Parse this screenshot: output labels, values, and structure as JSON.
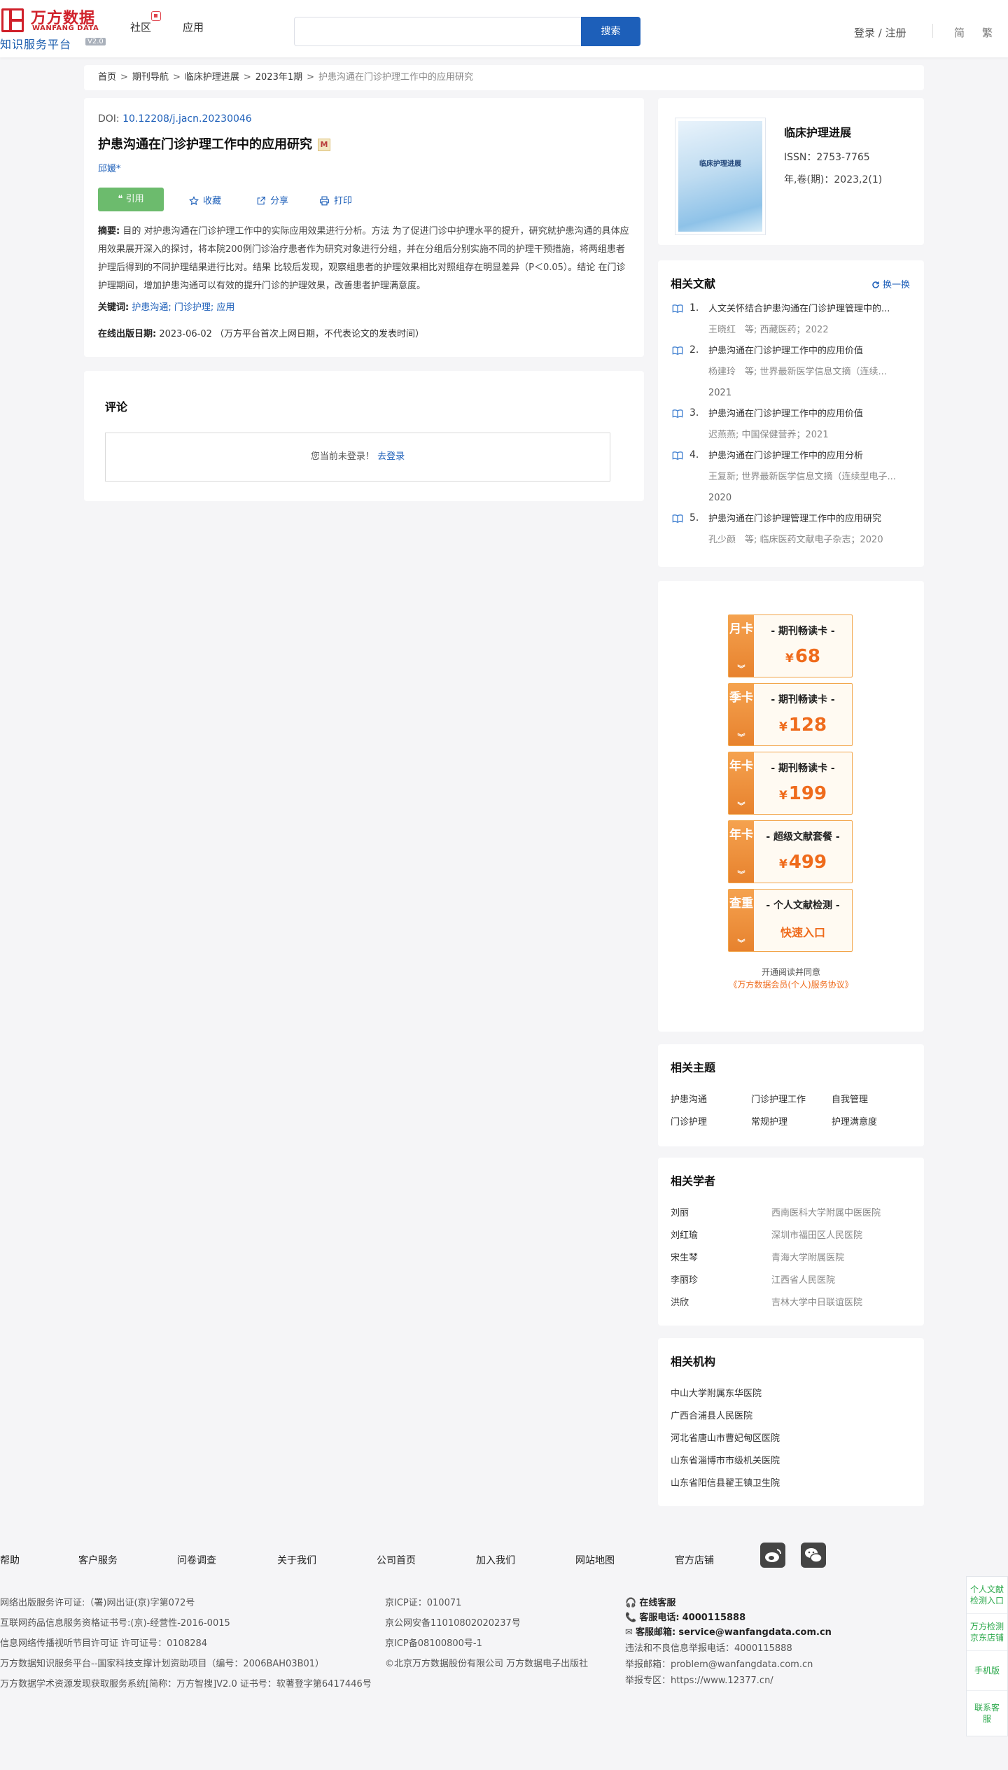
{
  "header": {
    "logo_cn": "万方数据",
    "logo_en": "WANFANG DATA",
    "logo_sub": "知识服务平台",
    "logo_version": "V2.0",
    "nav_community": "社区",
    "nav_apps": "应用",
    "search_placeholder": "",
    "search_button": "搜索",
    "login": "登录 / 注册",
    "lang_simplified": "简",
    "lang_traditional": "繁"
  },
  "breadcrumb": [
    "首页",
    "期刊导航",
    "临床护理进展",
    "2023年1期",
    "护患沟通在门诊护理工作中的应用研究"
  ],
  "article": {
    "doi_label": "DOI: ",
    "doi": "10.12208/j.jacn.20230046",
    "title": "护患沟通在门诊护理工作中的应用研究",
    "m_badge": "M",
    "author": "邱媛*",
    "cite": "引用",
    "favorite": "收藏",
    "share": "分享",
    "print": "打印",
    "abstract_label": "摘要:",
    "abstract_text": " 目的 对护患沟通在门诊护理工作中的实际应用效果进行分析。方法 为了促进门诊中护理水平的提升，研究就护患沟通的具体应用效果展开深入的探讨，将本院200例门诊治疗患者作为研究对象进行分组，并在分组后分别实施不同的护理干预措施，将两组患者护理后得到的不同护理结果进行比对。结果 比较后发现，观察组患者的护理效果相比对照组存在明显差异（P＜0.05）。结论 在门诊护理期间，增加护患沟通可以有效的提升门诊的护理效果，改善患者护理满意度。",
    "keywords_label": "关键词:",
    "keywords": "护患沟通; 门诊护理; 应用",
    "pubdate_label": "在线出版日期:",
    "pubdate": "2023-06-02 （万方平台首次上网日期，不代表论文的发表时间）"
  },
  "comment": {
    "heading": "评论",
    "not_logged": "您当前未登录！",
    "go_login": "去登录"
  },
  "journal": {
    "cover_text": "临床护理进展",
    "name": "临床护理进展",
    "issn": "ISSN：2753-7765",
    "vol": "年,卷(期)：2023,2(1)"
  },
  "related": {
    "heading": "相关文献",
    "refresh": "换一换",
    "items": [
      {
        "num": "1.",
        "title": "人文关怀结合护患沟通在门诊护理管理中的...",
        "meta": "王晓红　等;  西藏医药；2022",
        "year": ""
      },
      {
        "num": "2.",
        "title": "护患沟通在门诊护理工作中的应用价值",
        "meta": "杨建玲　等;  世界最新医学信息文摘（连续...",
        "year": "2021"
      },
      {
        "num": "3.",
        "title": "护患沟通在门诊护理工作中的应用价值",
        "meta": "迟燕燕;  中国保健营养；2021",
        "year": ""
      },
      {
        "num": "4.",
        "title": "护患沟通在门诊护理工作中的应用分析",
        "meta": "王复新;  世界最新医学信息文摘（连续型电子...",
        "year": "2020"
      },
      {
        "num": "5.",
        "title": "护患沟通在门诊护理管理工作中的应用研究",
        "meta": "孔少颜　等;  临床医药文献电子杂志；2020",
        "year": ""
      }
    ]
  },
  "promo": {
    "cards": [
      {
        "tag": "月卡",
        "title": "- 期刊畅读卡 -",
        "price": "68",
        "entry": ""
      },
      {
        "tag": "季卡",
        "title": "- 期刊畅读卡 -",
        "price": "128",
        "entry": ""
      },
      {
        "tag": "年卡",
        "title": "- 期刊畅读卡 -",
        "price": "199",
        "entry": ""
      },
      {
        "tag": "年卡",
        "title": "- 超级文献套餐 -",
        "price": "499",
        "entry": ""
      },
      {
        "tag": "查重",
        "title": "- 个人文献检测 -",
        "price": "",
        "entry": "快速入口"
      }
    ],
    "yen": "¥",
    "chevron": "︾",
    "note": "开通阅读并同意",
    "agreement": "《万方数据会员(个人)服务协议》"
  },
  "topics": {
    "heading": "相关主题",
    "items": [
      "护患沟通",
      "门诊护理工作",
      "自我管理",
      "门诊护理",
      "常规护理",
      "护理满意度"
    ]
  },
  "scholars": {
    "heading": "相关学者",
    "items": [
      {
        "name": "刘丽",
        "org": "西南医科大学附属中医医院"
      },
      {
        "name": "刘红瑜",
        "org": "深圳市福田区人民医院"
      },
      {
        "name": "宋生琴",
        "org": "青海大学附属医院"
      },
      {
        "name": "李丽珍",
        "org": "江西省人民医院"
      },
      {
        "name": "洪欣",
        "org": "吉林大学中日联谊医院"
      }
    ]
  },
  "orgs": {
    "heading": "相关机构",
    "items": [
      "中山大学附属东华医院",
      "广西合浦县人民医院",
      "河北省唐山市曹妃甸区医院",
      "山东省淄博市市级机关医院",
      "山东省阳信县翟王镇卫生院"
    ]
  },
  "footer": {
    "nav": [
      "帮助",
      "客户服务",
      "问卷调查",
      "关于我们",
      "公司首页",
      "加入我们",
      "网站地图",
      "官方店铺"
    ],
    "left_lines": [
      "网络出版服务许可证:（署)网出证(京)字第072号",
      "互联网药品信息服务资格证书号:(京)-经营性-2016-0015",
      "信息网络传播视听节目许可证 许可证号：0108284",
      "万方数据知识服务平台--国家科技支撑计划资助项目（编号：2006BAH03B01）",
      "万方数据学术资源发现获取服务系统[简称：万方智搜]V2.0 证书号：软著登字第6417446号"
    ],
    "mid_lines": [
      "京ICP证：010071",
      "京公网安备11010802020237号",
      "京ICP备08100800号-1",
      "©北京万方数据股份有限公司 万方数据电子出版社"
    ],
    "online_service": "在线客服",
    "phone_label": "客服电话:",
    "phone": "4000115888",
    "email_label": "客服邮箱:",
    "email": "service@wanfangdata.com.cn",
    "report_phone": "违法和不良信息举报电话：4000115888",
    "report_email": "举报邮箱：problem@wanfangdata.com.cn",
    "report_zone": "举报专区：https://www.12377.cn/"
  },
  "floatbar": [
    "个人文献检测入口",
    "万方检测京东店铺",
    "手机版",
    "联系客服"
  ]
}
